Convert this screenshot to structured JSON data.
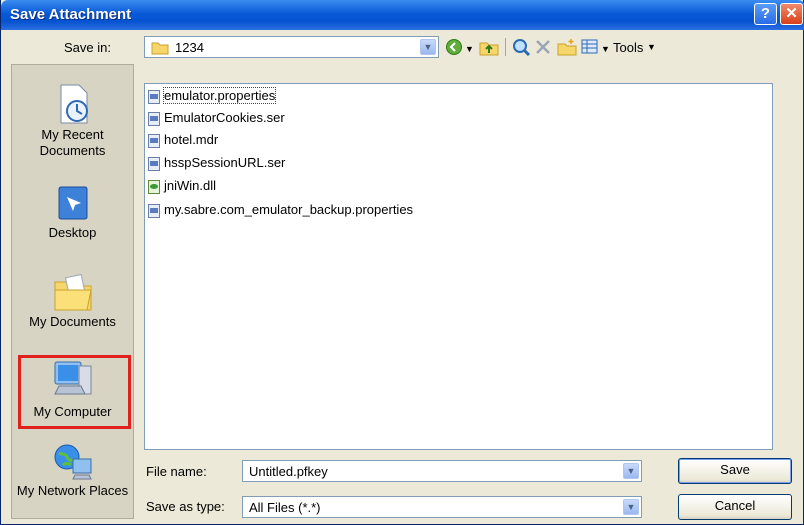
{
  "window": {
    "title": "Save Attachment",
    "help_glyph": "?",
    "close_glyph": "✕"
  },
  "save_in": {
    "label": "Save in:",
    "value": "1234"
  },
  "toolbar": {
    "tools_label": "Tools",
    "icons": [
      "back-icon",
      "up-folder-icon",
      "search-web-icon",
      "delete-icon",
      "new-folder-icon",
      "views-icon"
    ]
  },
  "places": [
    {
      "label": "My Recent Documents",
      "icon": "recent-documents-icon"
    },
    {
      "label": "Desktop",
      "icon": "desktop-icon"
    },
    {
      "label": "My Documents",
      "icon": "my-documents-icon"
    },
    {
      "label": "My Computer",
      "icon": "my-computer-icon",
      "highlighted": true
    },
    {
      "label": "My Network Places",
      "icon": "network-places-icon"
    }
  ],
  "files": [
    {
      "name": "emulator.properties",
      "type": "doc",
      "selected": true
    },
    {
      "name": "EmulatorCookies.ser",
      "type": "doc"
    },
    {
      "name": "hotel.mdr",
      "type": "doc"
    },
    {
      "name": "hsspSessionURL.ser",
      "type": "doc"
    },
    {
      "name": "jniWin.dll",
      "type": "dll"
    },
    {
      "name": "my.sabre.com_emulator_backup.properties",
      "type": "doc"
    }
  ],
  "file_name": {
    "label": "File name:",
    "value": "Untitled.pfkey"
  },
  "save_as_type": {
    "label": "Save as type:",
    "value": "All Files (*.*)"
  },
  "buttons": {
    "save": "Save",
    "cancel": "Cancel"
  },
  "colors": {
    "title_bar": "#0553d0",
    "dialog_bg": "#ece9d8",
    "highlight_box": "#e0201c"
  }
}
